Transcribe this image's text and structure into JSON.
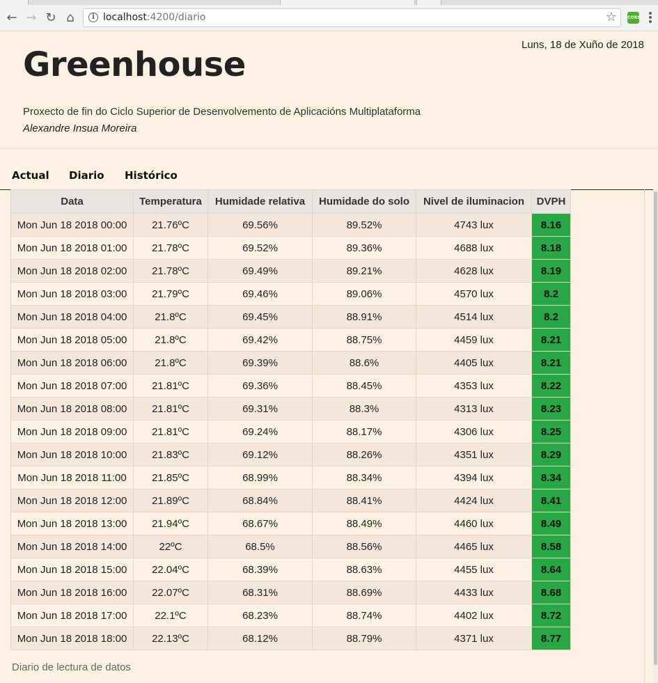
{
  "browser": {
    "url_host": "localhost",
    "url_path": ":4200/diario",
    "extension_label": "CORS"
  },
  "header": {
    "date": "Luns, 18 de Xuño de 2018",
    "brand": "Greenhouse",
    "subtitle": "Proxecto de fin do Ciclo Superior de Desenvolvemento de Aplicacións Multiplataforma",
    "author": "Alexandre Insua Moreira"
  },
  "nav": {
    "tabs": [
      {
        "label": "Actual"
      },
      {
        "label": "Diario"
      },
      {
        "label": "Histórico"
      }
    ]
  },
  "table": {
    "columns": [
      "Data",
      "Temperatura",
      "Humidade relativa",
      "Humidade do solo",
      "Nivel de iluminacion",
      "DVPH"
    ],
    "rows": [
      [
        "Mon Jun 18 2018 00:00",
        "21.76ºC",
        "69.56%",
        "89.52%",
        "4743 lux",
        "8.16"
      ],
      [
        "Mon Jun 18 2018 01:00",
        "21.78ºC",
        "69.52%",
        "89.36%",
        "4688 lux",
        "8.18"
      ],
      [
        "Mon Jun 18 2018 02:00",
        "21.78ºC",
        "69.49%",
        "89.21%",
        "4628 lux",
        "8.19"
      ],
      [
        "Mon Jun 18 2018 03:00",
        "21.79ºC",
        "69.46%",
        "89.06%",
        "4570 lux",
        "8.2"
      ],
      [
        "Mon Jun 18 2018 04:00",
        "21.8ºC",
        "69.45%",
        "88.91%",
        "4514 lux",
        "8.2"
      ],
      [
        "Mon Jun 18 2018 05:00",
        "21.8ºC",
        "69.42%",
        "88.75%",
        "4459 lux",
        "8.21"
      ],
      [
        "Mon Jun 18 2018 06:00",
        "21.8ºC",
        "69.39%",
        "88.6%",
        "4405 lux",
        "8.21"
      ],
      [
        "Mon Jun 18 2018 07:00",
        "21.81ºC",
        "69.36%",
        "88.45%",
        "4353 lux",
        "8.22"
      ],
      [
        "Mon Jun 18 2018 08:00",
        "21.81ºC",
        "69.31%",
        "88.3%",
        "4313 lux",
        "8.23"
      ],
      [
        "Mon Jun 18 2018 09:00",
        "21.81ºC",
        "69.24%",
        "88.17%",
        "4306 lux",
        "8.25"
      ],
      [
        "Mon Jun 18 2018 10:00",
        "21.83ºC",
        "69.12%",
        "88.26%",
        "4351 lux",
        "8.29"
      ],
      [
        "Mon Jun 18 2018 11:00",
        "21.85ºC",
        "68.99%",
        "88.34%",
        "4394 lux",
        "8.34"
      ],
      [
        "Mon Jun 18 2018 12:00",
        "21.89ºC",
        "68.84%",
        "88.41%",
        "4424 lux",
        "8.41"
      ],
      [
        "Mon Jun 18 2018 13:00",
        "21.94ºC",
        "68.67%",
        "88.49%",
        "4460 lux",
        "8.49"
      ],
      [
        "Mon Jun 18 2018 14:00",
        "22ºC",
        "68.5%",
        "88.56%",
        "4465 lux",
        "8.58"
      ],
      [
        "Mon Jun 18 2018 15:00",
        "22.04ºC",
        "68.39%",
        "88.63%",
        "4455 lux",
        "8.64"
      ],
      [
        "Mon Jun 18 2018 16:00",
        "22.07ºC",
        "68.31%",
        "88.69%",
        "4433 lux",
        "8.68"
      ],
      [
        "Mon Jun 18 2018 17:00",
        "22.1ºC",
        "68.23%",
        "88.74%",
        "4402 lux",
        "8.72"
      ],
      [
        "Mon Jun 18 2018 18:00",
        "22.13ºC",
        "68.12%",
        "88.79%",
        "4371 lux",
        "8.77"
      ]
    ]
  },
  "footer": {
    "caption": "Diario de lectura de datos"
  },
  "colors": {
    "page_bg": "#fdf1e4",
    "row_stripe": "#f3e6da",
    "dvph_ok": "#28a745"
  }
}
